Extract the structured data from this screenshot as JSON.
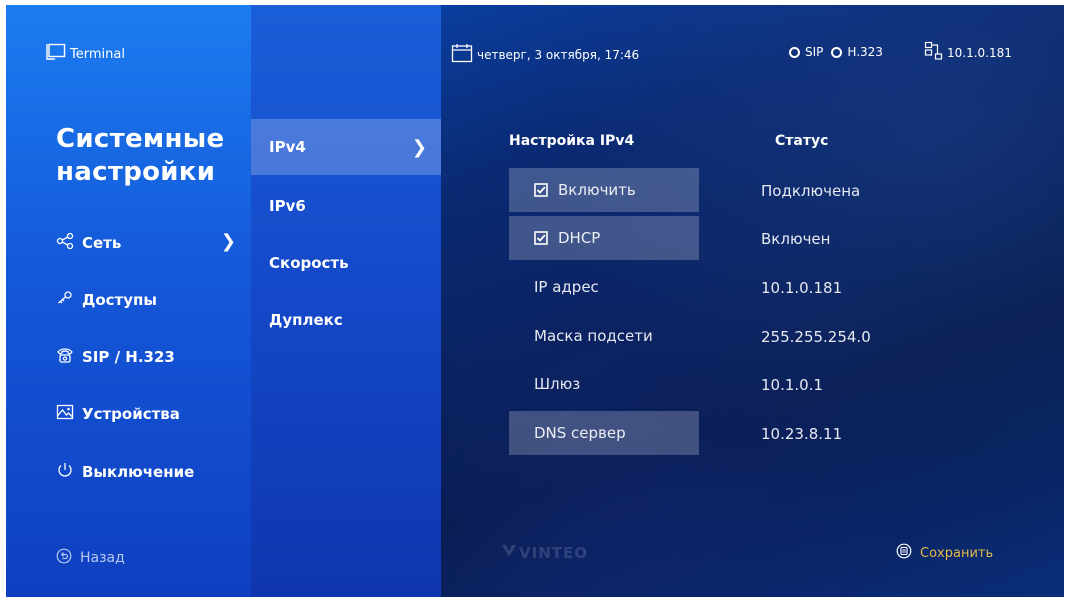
{
  "app": {
    "title": "Terminal"
  },
  "page": {
    "title_line1": "Системные",
    "title_line2": "настройки"
  },
  "sidebar": {
    "items": [
      {
        "label": "Сеть",
        "icon": "network-icon"
      },
      {
        "label": "Доступы",
        "icon": "access-icon"
      },
      {
        "label": "SIP / H.323",
        "icon": "phone-icon"
      },
      {
        "label": "Устройства",
        "icon": "devices-icon"
      },
      {
        "label": "Выключение",
        "icon": "power-icon"
      }
    ],
    "back_label": "Назад"
  },
  "submenu": {
    "items": [
      "IPv4",
      "IPv6",
      "Скорость",
      "Дуплекс"
    ]
  },
  "topbar": {
    "datetime": "четверг, 3 октября, 17:46",
    "sip": "SIP",
    "h323": "H.323",
    "ip": "10.1.0.181"
  },
  "main": {
    "settings_header": "Настройка IPv4",
    "status_header": "Статус",
    "rows": [
      {
        "label": "Включить",
        "value": "Подключена"
      },
      {
        "label": "DHCP",
        "value": "Включен"
      },
      {
        "label": "IP адрес",
        "value": "10.1.0.181"
      },
      {
        "label": "Маска подсети",
        "value": "255.255.254.0"
      },
      {
        "label": "Шлюз",
        "value": "10.1.0.1"
      },
      {
        "label": "DNS сервер",
        "value": "10.23.8.11"
      }
    ]
  },
  "footer": {
    "logo": "VINTEO",
    "save_label": "Сохранить"
  },
  "colors": {
    "accent_gold": "#e5b84a",
    "sidebar_blue": "#1c7cf0",
    "content_dark": "#071a4a"
  }
}
